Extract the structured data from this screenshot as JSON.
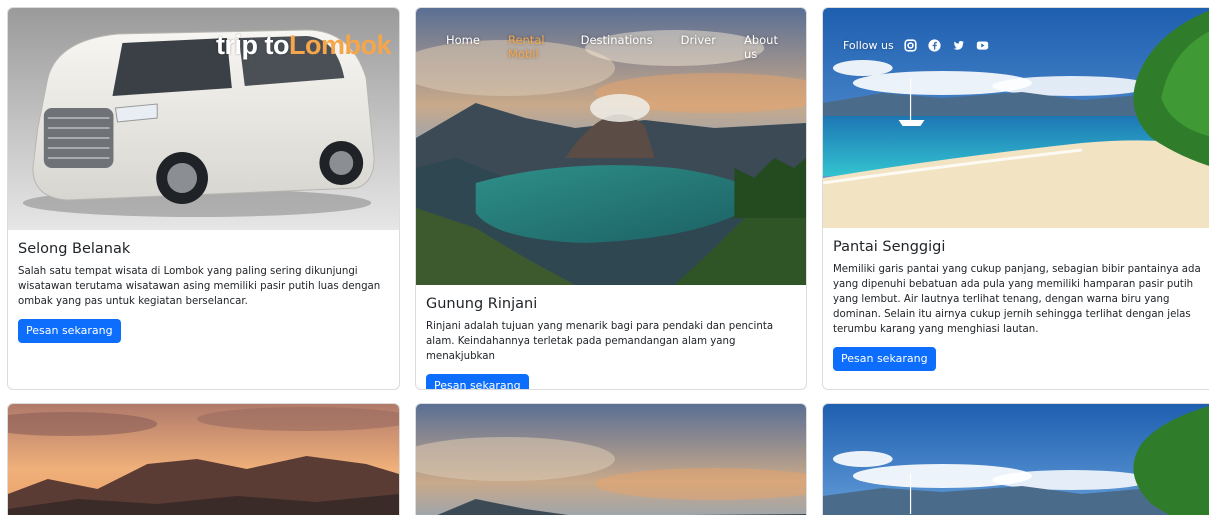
{
  "brand": {
    "part1": "trip to",
    "part2": "Lombok"
  },
  "nav": {
    "items": [
      {
        "label": "Home"
      },
      {
        "label": "Rental Mobil"
      },
      {
        "label": "Destinations"
      },
      {
        "label": "Driver"
      },
      {
        "label": "About us"
      }
    ],
    "active_index": 1
  },
  "social": {
    "label": "Follow us",
    "icons": [
      "instagram-icon",
      "facebook-icon",
      "twitter-icon",
      "youtube-icon"
    ]
  },
  "cards": [
    {
      "title": "Selong Belanak",
      "text": "Salah satu tempat wisata di Lombok yang paling sering dikunjungi wisatawan terutama wisatawan asing memiliki pasir putih luas dengan ombak yang pas untuk kegiatan berselancar.",
      "button": "Pesan sekarang"
    },
    {
      "title": "Gunung Rinjani",
      "text": "Rinjani adalah tujuan yang menarik bagi para pendaki dan pencinta alam. Keindahannya terletak pada pemandangan alam yang menakjubkan",
      "button": "Pesan sekarang"
    },
    {
      "title": "Pantai Senggigi",
      "text": "Memiliki garis pantai yang cukup panjang, sebagian bibir pantainya ada yang dipenuhi bebatuan ada pula yang memiliki hamparan pasir putih yang lembut. Air lautnya terlihat tenang, dengan warna biru yang dominan. Selain itu airnya cukup jernih sehingga terlihat dengan jelas terumbu karang yang menghiasi lautan.",
      "button": "Pesan sekarang"
    }
  ],
  "colors": {
    "primary_button": "#0d6efd",
    "brand_accent": "#f5a64a",
    "card_border": "#dcdcdc"
  }
}
